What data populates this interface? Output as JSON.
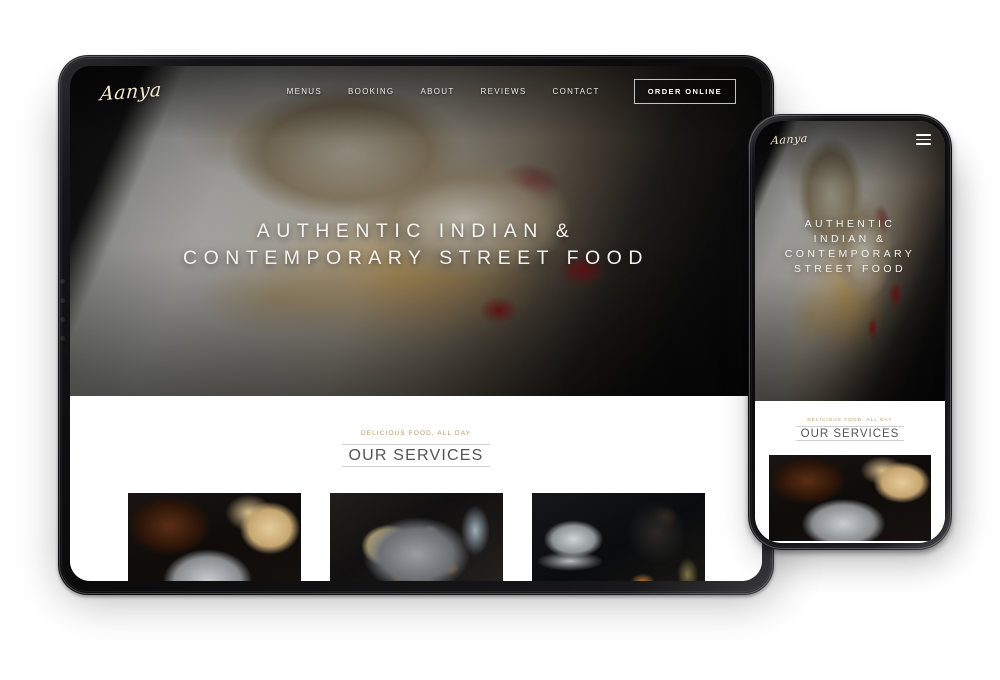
{
  "brand": {
    "logo": "Aanya"
  },
  "nav": {
    "links": [
      {
        "label": "MENUS"
      },
      {
        "label": "BOOKING"
      },
      {
        "label": "ABOUT"
      },
      {
        "label": "REVIEWS"
      },
      {
        "label": "CONTACT"
      }
    ],
    "cta": "ORDER ONLINE",
    "mobile_menu_icon": "hamburger-menu-icon"
  },
  "hero": {
    "title_line1": "AUTHENTIC INDIAN &",
    "title_line2": "CONTEMPORARY STREET FOOD",
    "mobile_title_line1": "AUTHENTIC",
    "mobile_title_line2": "INDIAN &",
    "mobile_title_line3": "CONTEMPORARY",
    "mobile_title_line4": "STREET FOOD",
    "photo_alt": "pani-puri-platter-photo"
  },
  "services": {
    "eyebrow": "DELICIOUS FOOD, ALL DAY",
    "title": "OUR SERVICES",
    "cards": [
      {
        "photo_alt": "curry-bowls-with-naan-photo"
      },
      {
        "photo_alt": "indian-thali-platter-photo"
      },
      {
        "photo_alt": "bartender-making-cocktail-photo"
      }
    ]
  },
  "devices": {
    "tablet_label": "tablet-mockup",
    "phone_label": "phone-mockup"
  },
  "colors": {
    "accent_gold": "#b99a63",
    "logo_cream": "#f4e8cf",
    "heading_gray": "#545454",
    "page_background": "#ffffff",
    "device_bezel": "#0b0b0c"
  }
}
